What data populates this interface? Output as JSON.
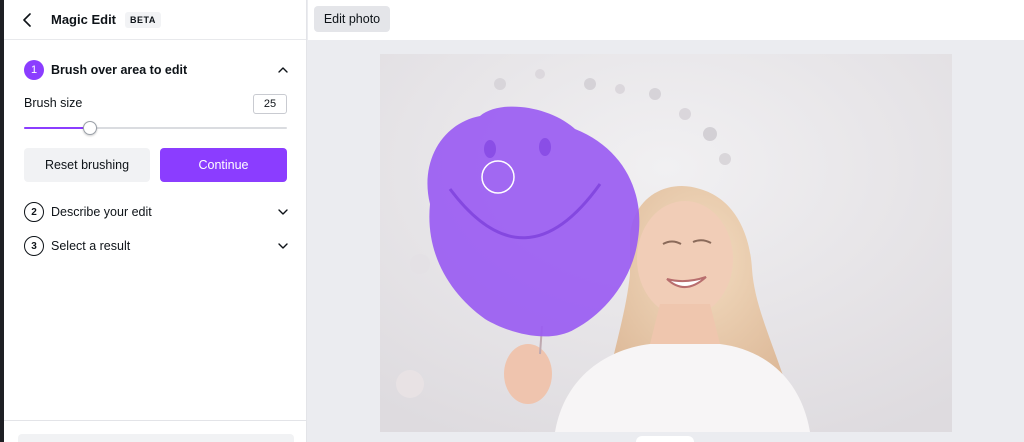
{
  "panel": {
    "title": "Magic Edit",
    "badge": "BETA",
    "steps": [
      {
        "number": "1",
        "label": "Brush over area to edit",
        "state": "expanded"
      },
      {
        "number": "2",
        "label": "Describe your edit",
        "state": "collapsed"
      },
      {
        "number": "3",
        "label": "Select a result",
        "state": "collapsed"
      }
    ],
    "brush": {
      "label": "Brush size",
      "value": "25",
      "fraction": 0.25
    },
    "reset_label": "Reset brushing",
    "continue_label": "Continue"
  },
  "toolbar": {
    "edit_photo_label": "Edit photo"
  },
  "colors": {
    "accent": "#8b3dff",
    "brush_overlay": "#9a5cf2"
  },
  "icons": {
    "back": "chevron-left-icon",
    "expand": "chevron-up-icon",
    "collapse": "chevron-down-icon",
    "cursor": "brush-cursor-icon"
  }
}
